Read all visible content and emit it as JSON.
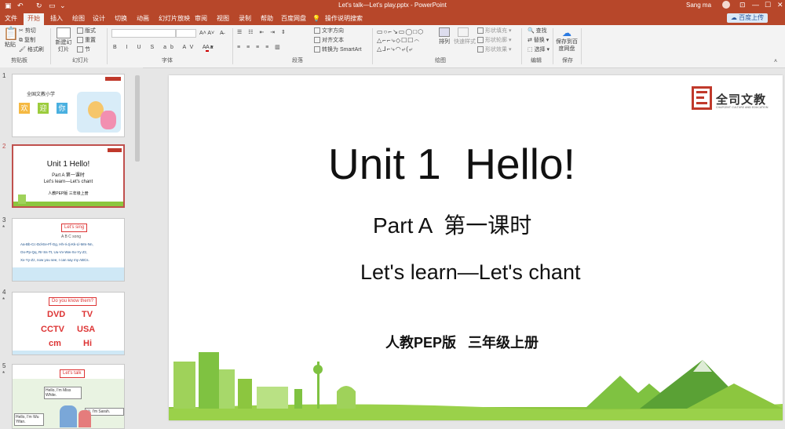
{
  "titlebar": {
    "title": "Let's talk—Let's play.pptx  -  PowerPoint",
    "user": "Sang ma"
  },
  "menu": {
    "tabs": [
      "文件",
      "开始",
      "插入",
      "绘图",
      "设计",
      "切换",
      "动画",
      "幻灯片放映",
      "审阅",
      "视图",
      "录制",
      "帮助",
      "百度网盘"
    ],
    "active_tab": "开始",
    "tell_me": "操作说明搜索",
    "share_label": "百度上传"
  },
  "ribbon": {
    "clipboard": {
      "paste": "粘贴",
      "cut": "剪切",
      "copy": "复制",
      "format_painter": "格式刷",
      "group": "剪贴板"
    },
    "slides": {
      "new_slide": "新建幻灯片",
      "layout": "版式",
      "reset": "重置",
      "section": "节",
      "group": "幻灯片"
    },
    "font": {
      "group": "字体"
    },
    "paragraph": {
      "text_direction": "文字方向",
      "align_text": "对齐文本",
      "smartart": "转换为 SmartArt",
      "group": "段落"
    },
    "drawing": {
      "arrange": "排列",
      "quick_styles": "快速样式",
      "shape_fill": "形状填充",
      "shape_outline": "形状轮廓",
      "shape_effects": "形状效果",
      "group": "绘图"
    },
    "editing": {
      "find": "查找",
      "replace": "替换",
      "select": "选择",
      "group": "编辑"
    },
    "save": {
      "save_baidu": "保存到百度网盘",
      "group": "保存"
    }
  },
  "thumbnails": [
    {
      "number": "1",
      "school": "全国文教小学",
      "welcome": [
        "欢",
        "迎",
        "你"
      ]
    },
    {
      "number": "2",
      "title": "Unit 1  Hello!",
      "part": "Part A  第一课时",
      "lesson": "Let's learn—Let's chant",
      "book": "人教PEP版  三年级上册"
    },
    {
      "number": "3",
      "star": "*",
      "banner": "Let's sing",
      "caption": "A B C song",
      "lines": [
        "Aa-Bb-Cc-Dd-Ee-Ff-Gg, Hh-Ii-Jj-Kk-Ll-Mm-Nn,",
        "Oo-Pp-Qq, Rr-Ss-Tt, Uu-Vv-Ww-Xx-Yy-Zz,",
        "Xx-Yy-Zz, now you see, I can say my ABCs."
      ]
    },
    {
      "number": "4",
      "star": "*",
      "banner": "Do you know them?",
      "words": [
        "DVD",
        "TV",
        "CCTV",
        "USA",
        "cm",
        "Hi"
      ]
    },
    {
      "number": "5",
      "star": "*",
      "banner": "Let's talk",
      "bubble1": "Hello, I'm Miss White.",
      "bubble2": "Hi, I'm Sarah.",
      "bubble3": "Hello, I'm Wu Yifan."
    }
  ],
  "slide": {
    "logo_text": "全司文教",
    "logo_sub": "CHAPCENT CULTURE AND EDUCATION",
    "title": "Unit 1  Hello!",
    "part": "Part A  第一课时",
    "lesson": "Let's learn—Let's chant",
    "book": "人教PEP版   三年级上册"
  },
  "colors": {
    "accent": "#b7472a",
    "red_logo": "#c0392b",
    "grass": "#8cc63f",
    "building": "#7fc241"
  }
}
